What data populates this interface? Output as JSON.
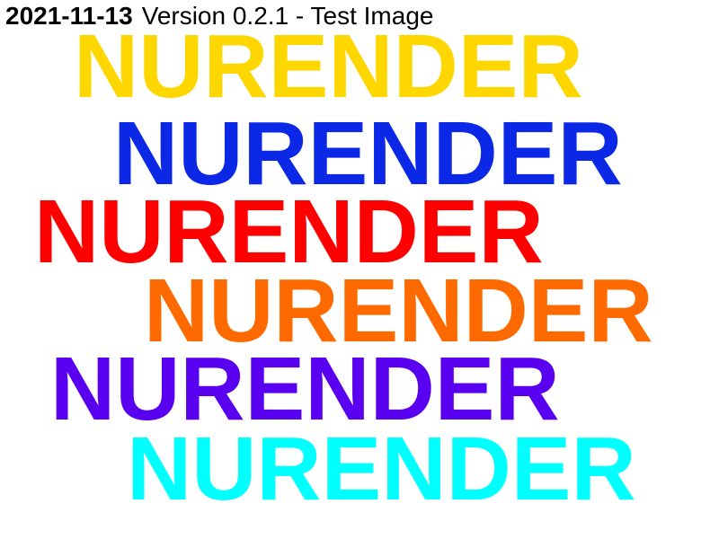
{
  "header": {
    "date": "2021-11-13",
    "version_text": "Version 0.2.1 - Test Image"
  },
  "words": [
    {
      "text": "NURENDER",
      "color": "#FFD700"
    },
    {
      "text": "NURENDER",
      "color": "#0A28E6"
    },
    {
      "text": "NURENDER",
      "color": "#FF0000"
    },
    {
      "text": "NURENDER",
      "color": "#FF6A00"
    },
    {
      "text": "NURENDER",
      "color": "#5A00F0"
    },
    {
      "text": "NURENDER",
      "color": "#00FFFF"
    }
  ]
}
